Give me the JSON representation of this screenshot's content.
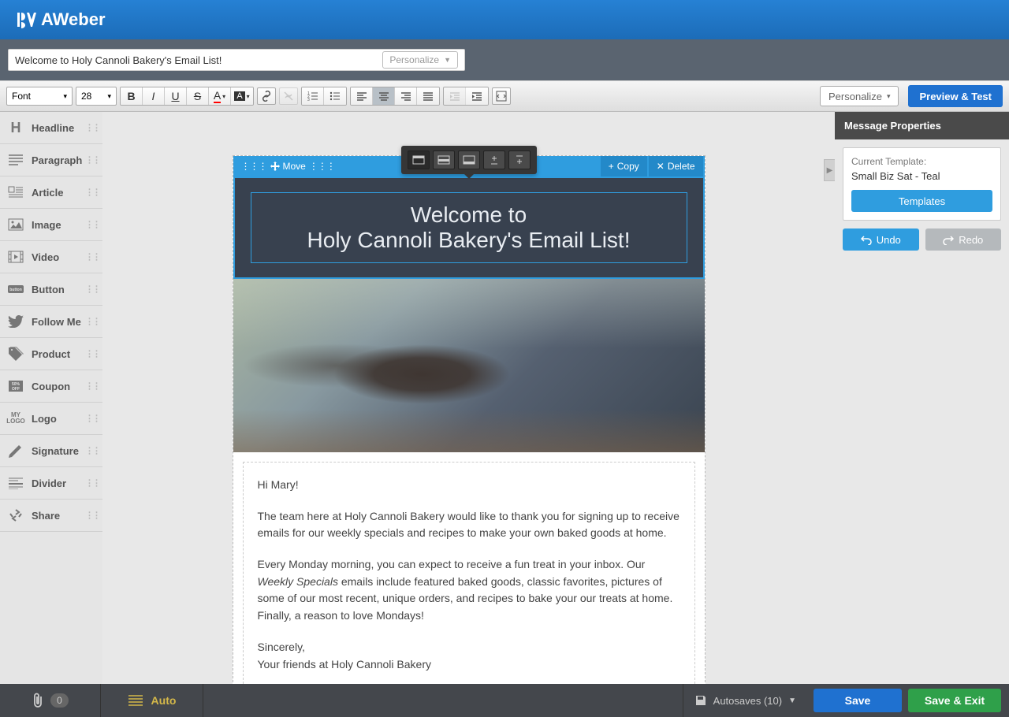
{
  "brand": "AWeber",
  "subject": "Welcome to Holy Cannoli Bakery's Email List!",
  "subject_personalize": "Personalize",
  "toolbar": {
    "font_label": "Font",
    "font_size": "28",
    "personalize": "Personalize",
    "preview": "Preview & Test"
  },
  "sidebar": {
    "items": [
      {
        "label": "Headline",
        "icon": "H"
      },
      {
        "label": "Paragraph",
        "icon": "para"
      },
      {
        "label": "Article",
        "icon": "article"
      },
      {
        "label": "Image",
        "icon": "image"
      },
      {
        "label": "Video",
        "icon": "video"
      },
      {
        "label": "Button",
        "icon": "button"
      },
      {
        "label": "Follow Me",
        "icon": "twitter"
      },
      {
        "label": "Product",
        "icon": "tag"
      },
      {
        "label": "Coupon",
        "icon": "coupon"
      },
      {
        "label": "Logo",
        "icon": "logo"
      },
      {
        "label": "Signature",
        "icon": "pen"
      },
      {
        "label": "Divider",
        "icon": "divider"
      },
      {
        "label": "Share",
        "icon": "share"
      }
    ]
  },
  "block_controls": {
    "move": "Move",
    "copy": "Copy",
    "delete": "Delete"
  },
  "headline": {
    "line1": "Welcome to",
    "line2": "Holy Cannoli Bakery's Email List!"
  },
  "body": {
    "greeting": "Hi Mary!",
    "p1": "The team here at Holy Cannoli Bakery would like to thank you for signing up to receive emails for our weekly specials and recipes to make your own baked goods at home.",
    "p2a": "Every Monday morning, you can expect to receive a fun treat in your inbox. Our ",
    "p2em": "Weekly Specials",
    "p2b": " emails include featured baked goods, classic favorites, pictures of some of our most recent, unique orders, and recipes to bake your our treats at home. Finally, a reason to love Mondays!",
    "signoff1": "Sincerely,",
    "signoff2": "Your friends at Holy Cannoli Bakery"
  },
  "right_panel": {
    "title": "Message Properties",
    "current_template_label": "Current Template:",
    "current_template": "Small Biz Sat - Teal",
    "templates_btn": "Templates",
    "undo": "Undo",
    "redo": "Redo"
  },
  "bottom": {
    "attach_count": "0",
    "auto": "Auto",
    "autosaves": "Autosaves (10)",
    "save": "Save",
    "save_exit": "Save & Exit"
  }
}
